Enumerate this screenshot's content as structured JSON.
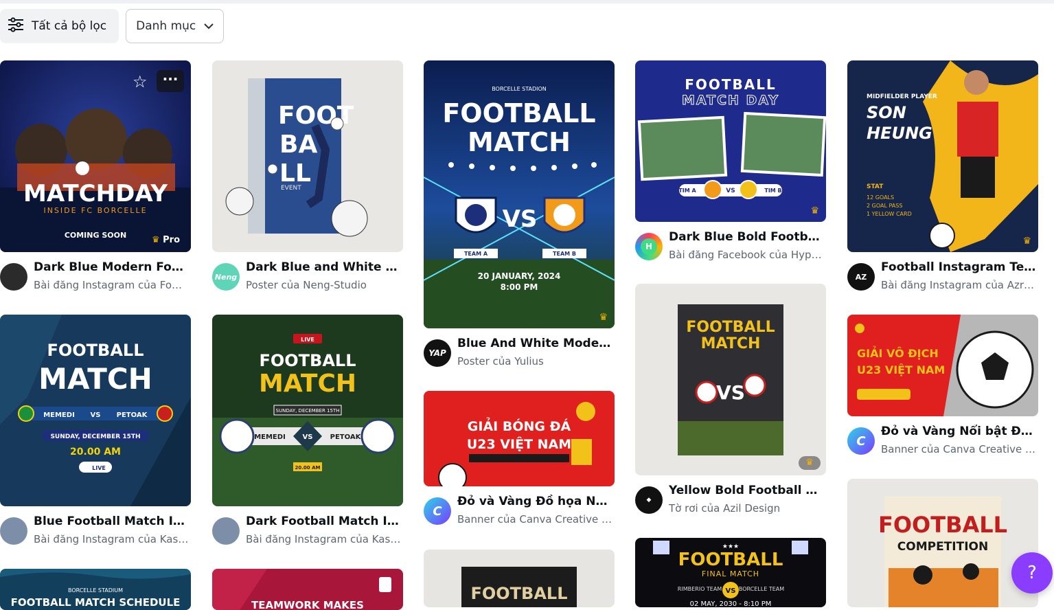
{
  "toolbar": {
    "filter_label": "Tất cả bộ lọc",
    "category_label": "Danh mục"
  },
  "cards": [
    {
      "title": "Dark Blue Modern Footb...",
      "subtitle": "Bài đăng Instagram của Foma...",
      "poster": [
        "MATCHDAY",
        "INSIDE FC BORCELLE",
        "COMING SOON"
      ],
      "badge": "Pro"
    },
    {
      "title": "Dark Blue and White Mo...",
      "subtitle": "Poster của Neng-Studio",
      "poster": [
        "FOOT",
        "BA",
        "LL",
        "EVENT"
      ],
      "avatar_text": "Neng"
    },
    {
      "title": "Blue And White Modern ...",
      "subtitle": "Poster của Yulius",
      "poster": [
        "FOOTBALL",
        "MATCH",
        "VS",
        "20 JANUARY, 2024",
        "8:00 PM",
        "BORCELLE STADION",
        "TEAM A",
        "TEAM B"
      ],
      "avatar_text": "YAP"
    },
    {
      "title": "Dark Blue Bold Football ...",
      "subtitle": "Bài đăng Facebook của Hyperi...",
      "poster": [
        "FOOTBALL",
        "MATCH DAY",
        "TIM A",
        "VS",
        "TIM B"
      ],
      "avatar_text": "H"
    },
    {
      "title": "Football Instagram Tem...",
      "subtitle": "Bài đăng Instagram của Azruca",
      "poster": [
        "MIDFIELDER PLAYER",
        "SON",
        "HEUNG",
        "STAT"
      ]
    },
    {
      "title": "Blue Football Match Inst...",
      "subtitle": "Bài đăng Instagram của Kasept",
      "poster": [
        "FOOTBALL",
        "MATCH",
        "MEMEDI",
        "VS",
        "PETOAK",
        "SUNDAY, DECEMBER 15TH",
        "20.00 AM",
        "LIVE"
      ]
    },
    {
      "title": "Dark Football Match Inst...",
      "subtitle": "Bài đăng Instagram của Kasept",
      "poster": [
        "LIVE",
        "FOOTBALL",
        "MATCH",
        "SUNDAY, DECEMBER 15TH",
        "MEMEDI",
        "VS",
        "PETOAK",
        "20.00 AM"
      ]
    },
    {
      "title": "Đỏ và Vàng Đồ họa Năng...",
      "subtitle": "Banner của Canva Creative Stu...",
      "poster": [
        "GIẢI BÓNG ĐÁ",
        "U23 VIỆT NAM"
      ],
      "avatar_text": "C"
    },
    {
      "title": "Yellow Bold Football Mat...",
      "subtitle": "Tờ rơi của Azil Design",
      "poster": [
        "FOOTBALL",
        "MATCH",
        "VS"
      ]
    },
    {
      "title": "Đỏ và Vàng Nổi bật Đội B...",
      "subtitle": "Banner của Canva Creative Stu...",
      "poster": [
        "GIẢI VÔ ĐỊCH",
        "U23 VIỆT NAM"
      ],
      "avatar_text": "C"
    },
    {
      "title": "",
      "subtitle": "",
      "poster": [
        "BORCELLE STADIUM",
        "FOOTBALL MATCH SCHEDULE"
      ]
    },
    {
      "title": "",
      "subtitle": "",
      "poster": [
        "TEAMWORK MAKES"
      ]
    },
    {
      "title": "",
      "subtitle": "",
      "poster": [
        "FOOTBALL"
      ]
    },
    {
      "title": "",
      "subtitle": "",
      "poster": [
        "FOOTBALL",
        "FINAL MATCH",
        "RIMBERIO TEAM",
        "VS",
        "BORCELLE TEAM",
        "02 MAY, 2030 - 8:10 PM"
      ]
    },
    {
      "title": "",
      "subtitle": "",
      "poster": [
        "FOOTBALL",
        "COMPETITION"
      ]
    }
  ],
  "help_label": "?",
  "colors": {
    "accent": "#8b3dff",
    "crown": "#f5b400",
    "navy": "#1b2a8c"
  }
}
